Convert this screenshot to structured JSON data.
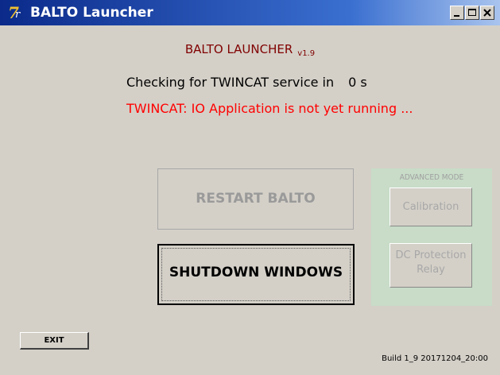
{
  "window": {
    "title": "BALTO Launcher",
    "icon": "balto-logo-icon"
  },
  "header": {
    "app_name": "BALTO LAUNCHER",
    "version": "v1.9"
  },
  "status": {
    "label": "Checking for TWINCAT service in",
    "countdown": "0 s",
    "error": "TWINCAT: IO Application is not yet running ..."
  },
  "buttons": {
    "restart": "RESTART BALTO",
    "shutdown": "SHUTDOWN WINDOWS",
    "exit": "EXIT"
  },
  "advanced": {
    "title": "ADVANCED MODE",
    "calibration": "Calibration",
    "dc_protection_line1": "DC Protection",
    "dc_protection_line2": "Relay"
  },
  "footer": {
    "build": "Build 1_9 20171204_20:00"
  },
  "colors": {
    "heading": "#800000",
    "error": "#ff0000",
    "panel_bg": "#c8dcc8",
    "window_bg": "#d4d0c8"
  }
}
